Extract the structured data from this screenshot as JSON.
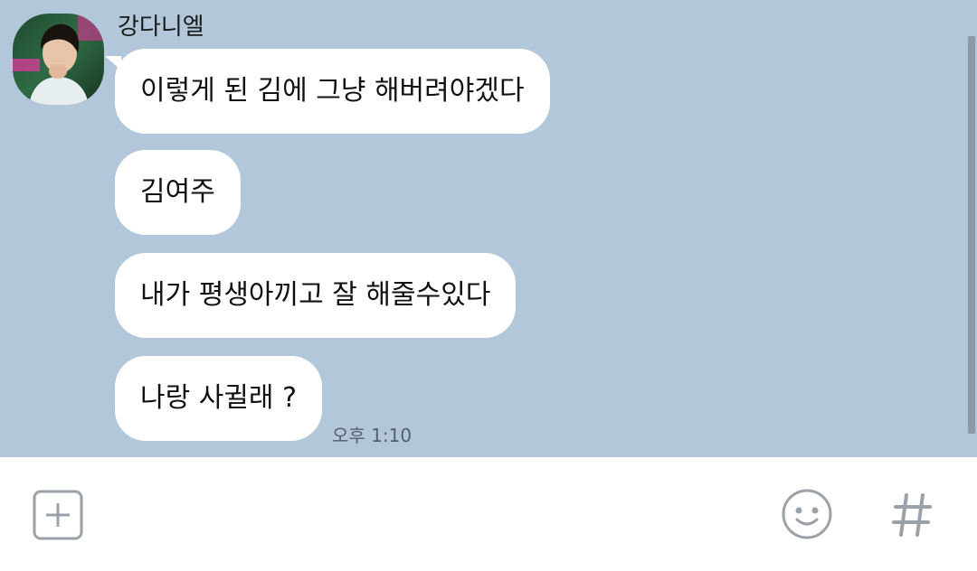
{
  "chat": {
    "sender_name": "강다니엘",
    "messages": [
      {
        "text": "이렇게 된 김에 그냥 해버려야겠다"
      },
      {
        "text": "김여주"
      },
      {
        "text": "내가 평생아끼고 잘 해줄수있다"
      },
      {
        "text": "나랑 사귈래 ?"
      }
    ],
    "last_message_time": "오후 1:10"
  },
  "input_bar": {
    "icons": [
      "plus-icon",
      "emoji-icon",
      "hashtag-icon"
    ]
  },
  "colors": {
    "chat_background": "#b2c7d9",
    "bubble": "#ffffff",
    "icon_gray": "#9aa1a8"
  }
}
